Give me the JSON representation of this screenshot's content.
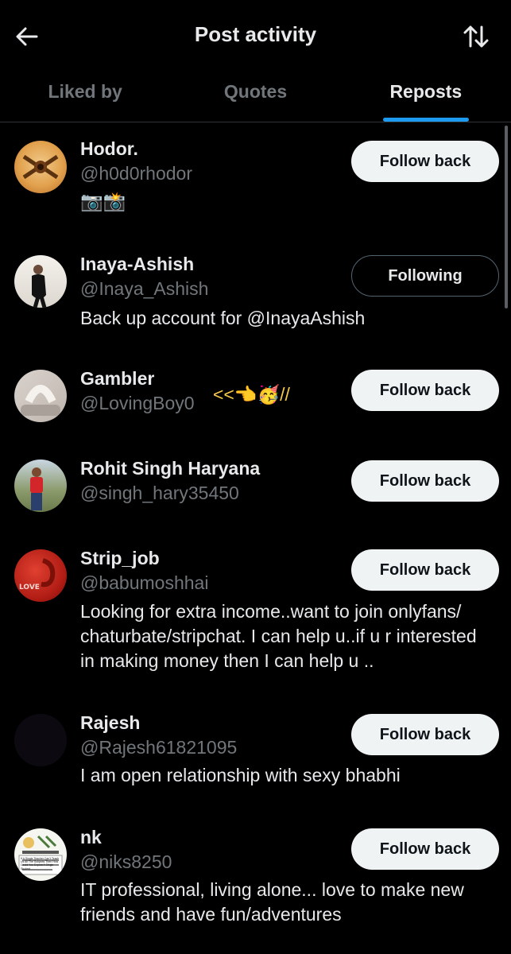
{
  "header": {
    "title": "Post activity"
  },
  "tabs": [
    {
      "label": "Liked by",
      "active": false
    },
    {
      "label": "Quotes",
      "active": false
    },
    {
      "label": "Reposts",
      "active": true
    }
  ],
  "users": [
    {
      "name": "Hodor.",
      "handle": "@h0d0rhodor",
      "bio": "📷📸",
      "button": "Follow back"
    },
    {
      "name": "Inaya-Ashish",
      "handle": "@Inaya_Ashish",
      "bio": "Back up account for @InayaAshish",
      "button": "Following"
    },
    {
      "name": "Gambler",
      "handle": "@LovingBoy0",
      "extra": "<<👈🥳//",
      "button": "Follow back"
    },
    {
      "name": "Rohit Singh Haryana",
      "handle": "@singh_hary35450",
      "button": "Follow back"
    },
    {
      "name": "Strip_job",
      "handle": "@babumoshhai",
      "bio": "Looking for extra income..want to join onlyfans/ chaturbate/stripchat. I can help u..if u r interested in making money then I can help u ..",
      "button": "Follow back",
      "avatar_text": "LOVE"
    },
    {
      "name": "Rajesh",
      "handle": "@Rajesh61821095",
      "bio": "I am open relationship with sexy bhabhi",
      "button": "Follow back"
    },
    {
      "name": "nk",
      "handle": "@niks8250",
      "bio": "IT professional, living alone... love to make new friends and have fun/adventures",
      "button": "Follow back",
      "avatar_text": "If A Single Teacher Can't Teach Us All The Subjects Then How Could You Expect A Single Student"
    }
  ]
}
